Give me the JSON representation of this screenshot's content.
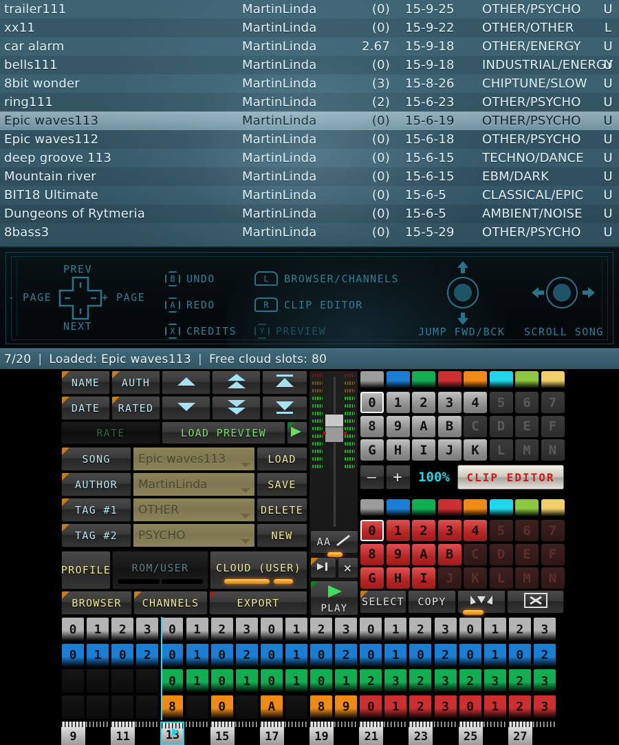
{
  "browser": {
    "columns": [
      "Name",
      "Author",
      "Rating",
      "Date",
      "Tags",
      "Flag"
    ],
    "rows": [
      {
        "name": "trailer111",
        "author": "MartinLinda",
        "rating": "(0)",
        "date": "15-9-25",
        "tags": "OTHER/PSYCHO",
        "flag": "U",
        "selected": false
      },
      {
        "name": "xx11",
        "author": "MartinLinda",
        "rating": "(0)",
        "date": "15-9-22",
        "tags": "OTHER/OTHER",
        "flag": "L",
        "selected": false
      },
      {
        "name": "car alarm",
        "author": "MartinLinda",
        "rating": "2.67",
        "date": "15-9-18",
        "tags": "OTHER/ENERGY",
        "flag": "U",
        "selected": false
      },
      {
        "name": "bells111",
        "author": "MartinLinda",
        "rating": "(0)",
        "date": "15-9-18",
        "tags": "INDUSTRIAL/ENERGY",
        "flag": "U",
        "selected": false
      },
      {
        "name": "8bit wonder",
        "author": "MartinLinda",
        "rating": "(3)",
        "date": "15-8-26",
        "tags": "CHIPTUNE/SLOW",
        "flag": "U",
        "selected": false
      },
      {
        "name": "ring111",
        "author": "MartinLinda",
        "rating": "(2)",
        "date": "15-6-23",
        "tags": "OTHER/PSYCHO",
        "flag": "U",
        "selected": false
      },
      {
        "name": "Epic waves113",
        "author": "MartinLinda",
        "rating": "(0)",
        "date": "15-6-19",
        "tags": "OTHER/PSYCHO",
        "flag": "U",
        "selected": true
      },
      {
        "name": "Epic waves112",
        "author": "MartinLinda",
        "rating": "(0)",
        "date": "15-6-18",
        "tags": "OTHER/PSYCHO",
        "flag": "U",
        "selected": false
      },
      {
        "name": "deep groove 113",
        "author": "MartinLinda",
        "rating": "(0)",
        "date": "15-6-15",
        "tags": "TECHNO/DANCE",
        "flag": "U",
        "selected": false
      },
      {
        "name": "Mountain river",
        "author": "MartinLinda",
        "rating": "(0)",
        "date": "15-6-15",
        "tags": "EBM/DARK",
        "flag": "U",
        "selected": false
      },
      {
        "name": "BIT18 Ultimate",
        "author": "MartinLinda",
        "rating": "(0)",
        "date": "15-6-5",
        "tags": "CLASSICAL/EPIC",
        "flag": "U",
        "selected": false
      },
      {
        "name": "Dungeons of Rytmeria",
        "author": "MartinLinda",
        "rating": "(0)",
        "date": "15-6-5",
        "tags": "AMBIENT/NOISE",
        "flag": "U",
        "selected": false
      },
      {
        "name": "8bass3",
        "author": "MartinLinda",
        "rating": "(0)",
        "date": "15-5-29",
        "tags": "OTHER/PSYCHO",
        "flag": "U",
        "selected": false
      }
    ]
  },
  "help": {
    "dpad": {
      "up": "PREV",
      "down": "NEXT",
      "left": "- PAGE",
      "right": "+ PAGE"
    },
    "face": [
      {
        "key": "B",
        "label": "UNDO",
        "dim": false
      },
      {
        "key": "A",
        "label": "REDO",
        "dim": false
      },
      {
        "key": "X",
        "label": "CREDITS",
        "dim": false
      }
    ],
    "shoulder": [
      {
        "key": "L",
        "label": "BROWSER/CHANNELS",
        "dim": false
      },
      {
        "key": "R",
        "label": "CLIP EDITOR",
        "dim": false
      },
      {
        "key": "Y",
        "label": "PREVIEW",
        "dim": true
      }
    ],
    "sticks": [
      {
        "label": "JUMP FWD/BCK",
        "axis": "vertical"
      },
      {
        "label": "SCROLL SONG",
        "axis": "horizontal"
      }
    ]
  },
  "status": {
    "page": "7/20",
    "sep": "|",
    "loaded": "Loaded: Epic waves113",
    "cloud": "Free cloud slots: 80"
  },
  "panel": {
    "sort_buttons": [
      {
        "label": "NAME",
        "corner": "orange"
      },
      {
        "label": "AUTH",
        "corner": "orange"
      },
      {
        "label": "UP",
        "icon": "arrow-up-icon",
        "corner": "none"
      },
      {
        "label": "PAGE UP",
        "icon": "arrow-double-up-icon",
        "corner": "none"
      },
      {
        "label": "TOP",
        "icon": "arrow-to-top-icon",
        "corner": "none"
      },
      {
        "label": "DATE",
        "corner": "orange"
      },
      {
        "label": "RATED",
        "corner": "orange"
      },
      {
        "label": "DOWN",
        "icon": "arrow-down-icon",
        "corner": "none"
      },
      {
        "label": "PAGE DOWN",
        "icon": "arrow-double-down-icon",
        "corner": "none"
      },
      {
        "label": "BOTTOM",
        "icon": "arrow-to-bottom-icon",
        "corner": "none"
      }
    ],
    "rate_label": "RATE",
    "load_preview_label": "LOAD PREVIEW",
    "preview_play_icon": "preview-play-icon",
    "fields": [
      {
        "label": "SONG",
        "value": "Epic waves113",
        "action": "LOAD"
      },
      {
        "label": "AUTHOR",
        "value": "MartinLinda",
        "action": "SAVE"
      },
      {
        "label": "TAG #1",
        "value": "OTHER",
        "action": "DELETE"
      },
      {
        "label": "TAG #2",
        "value": "PSYCHO",
        "action": "NEW"
      }
    ],
    "storage": {
      "profile_label": "PROFILE",
      "rom_user_label": "ROM/USER",
      "cloud_label": "CLOUD (USER)"
    },
    "nav": [
      {
        "label": "BROWSER",
        "corner": "orange",
        "active": true
      },
      {
        "label": "CHANNELS",
        "corner": "orange",
        "active": false
      },
      {
        "label": "EXPORT",
        "corner": "red",
        "active": false
      }
    ]
  },
  "mixer": {
    "left_meter_level": 6,
    "right_meter_level": 6,
    "fader_label": "volume-fader",
    "aa_button": "AA",
    "aa_icon": "diagonal-line-icon",
    "tab_icon": "tab-right-icon",
    "close_icon": "close-x-icon",
    "play_icon": "play-triangle-icon",
    "play_label": "PLAY"
  },
  "matrix_top": {
    "palette": [
      "#9c9c9c",
      "#1a7fd4",
      "#12ae52",
      "#cc2f2f",
      "#ef8b15",
      "#1fd7e8",
      "#8dc73f",
      "#f0cf6b"
    ],
    "rows": [
      {
        "keys": [
          {
            "t": "0",
            "on": true,
            "cur": true
          },
          {
            "t": "1",
            "on": true
          },
          {
            "t": "2",
            "on": true
          },
          {
            "t": "3",
            "on": true
          },
          {
            "t": "4",
            "on": true
          },
          {
            "t": "5",
            "on": false
          },
          {
            "t": "6",
            "on": false
          },
          {
            "t": "7",
            "on": false
          }
        ]
      },
      {
        "keys": [
          {
            "t": "8",
            "on": true
          },
          {
            "t": "9",
            "on": true
          },
          {
            "t": "A",
            "on": true
          },
          {
            "t": "B",
            "on": true
          },
          {
            "t": "C",
            "on": false
          },
          {
            "t": "D",
            "on": false
          },
          {
            "t": "E",
            "on": false
          },
          {
            "t": "F",
            "on": false
          }
        ]
      },
      {
        "keys": [
          {
            "t": "G",
            "on": true
          },
          {
            "t": "H",
            "on": true
          },
          {
            "t": "I",
            "on": true
          },
          {
            "t": "J",
            "on": true
          },
          {
            "t": "K",
            "on": true
          },
          {
            "t": "L",
            "on": false
          },
          {
            "t": "M",
            "on": false
          },
          {
            "t": "N",
            "on": false
          }
        ]
      }
    ],
    "minus": "–",
    "plus": "+",
    "zoom": "100%",
    "clip_editor": "CLIP EDITOR"
  },
  "matrix_bottom": {
    "palette": [
      "#9c9c9c",
      "#1a7fd4",
      "#12ae52",
      "#cc2f2f",
      "#ef8b15",
      "#1fd7e8",
      "#8dc73f",
      "#f0cf6b"
    ],
    "rows": [
      {
        "keys": [
          {
            "t": "0",
            "on": true,
            "cur": true
          },
          {
            "t": "1",
            "on": true
          },
          {
            "t": "2",
            "on": true
          },
          {
            "t": "3",
            "on": true
          },
          {
            "t": "4",
            "on": true
          },
          {
            "t": "5",
            "on": false
          },
          {
            "t": "6",
            "on": false
          },
          {
            "t": "7",
            "on": false
          }
        ]
      },
      {
        "keys": [
          {
            "t": "8",
            "on": true
          },
          {
            "t": "9",
            "on": true
          },
          {
            "t": "A",
            "on": true
          },
          {
            "t": "B",
            "on": true
          },
          {
            "t": "C",
            "on": false
          },
          {
            "t": "D",
            "on": false
          },
          {
            "t": "E",
            "on": false
          },
          {
            "t": "F",
            "on": false
          }
        ]
      },
      {
        "keys": [
          {
            "t": "G",
            "on": true
          },
          {
            "t": "H",
            "on": true
          },
          {
            "t": "I",
            "on": true
          },
          {
            "t": "J",
            "on": false
          },
          {
            "t": "K",
            "on": false
          },
          {
            "t": "L",
            "on": false
          },
          {
            "t": "M",
            "on": false
          },
          {
            "t": "N",
            "on": false
          }
        ]
      }
    ],
    "toolbar": [
      {
        "label": "SELECT",
        "corner": "orange"
      },
      {
        "label": "COPY",
        "corner": "none"
      },
      {
        "label": "PASTE",
        "icon": "paste-down-icon",
        "corner": "none"
      },
      {
        "label": "CLEAR",
        "icon": "boxed-x-icon",
        "corner": "none"
      }
    ]
  },
  "sequencer": {
    "columns": 20,
    "playhead_column": 4,
    "tracks": [
      {
        "color": "#b4b4b4",
        "cells": [
          "0",
          "1",
          "2",
          "3",
          "0",
          "1",
          "2",
          "3",
          "0",
          "1",
          "2",
          "3",
          "0",
          "1",
          "2",
          "3",
          "0",
          "1",
          "2",
          "3"
        ]
      },
      {
        "color": "#1a7fd4",
        "cells": [
          "0",
          "1",
          "0",
          "2",
          "0",
          "1",
          "0",
          "2",
          "0",
          "1",
          "0",
          "2",
          "0",
          "1",
          "0",
          "2",
          "0",
          "1",
          "0",
          "2"
        ]
      },
      {
        "color": "#12ae52",
        "cells": [
          "",
          "",
          "",
          "",
          "0",
          "1",
          "0",
          "1",
          "0",
          "1",
          "0",
          "1",
          "2",
          "3",
          "2",
          "3",
          "2",
          "3",
          "2",
          "3"
        ]
      },
      {
        "color": "#ef8b15",
        "cells": [
          "",
          "",
          "",
          "",
          "8",
          "",
          "0",
          "",
          "A",
          "",
          "8",
          "9",
          "0",
          "1",
          "2",
          "3",
          "0",
          "1",
          "2",
          "3"
        ],
        "overrides": {
          "12": "#cc2f2f",
          "13": "#cc2f2f",
          "14": "#cc2f2f",
          "15": "#cc2f2f",
          "16": "#cc2f2f",
          "17": "#cc2f2f",
          "18": "#cc2f2f",
          "19": "#cc2f2f"
        }
      }
    ],
    "ruler_labels": [
      "9",
      "",
      "11",
      "",
      "13",
      "",
      "15",
      "",
      "17",
      "",
      "19",
      "",
      "21",
      "",
      "23",
      "",
      "25",
      "",
      "27",
      ""
    ],
    "ruler_playhead_index": 4,
    "playhead_icon": "playhead-triangle-icon"
  }
}
